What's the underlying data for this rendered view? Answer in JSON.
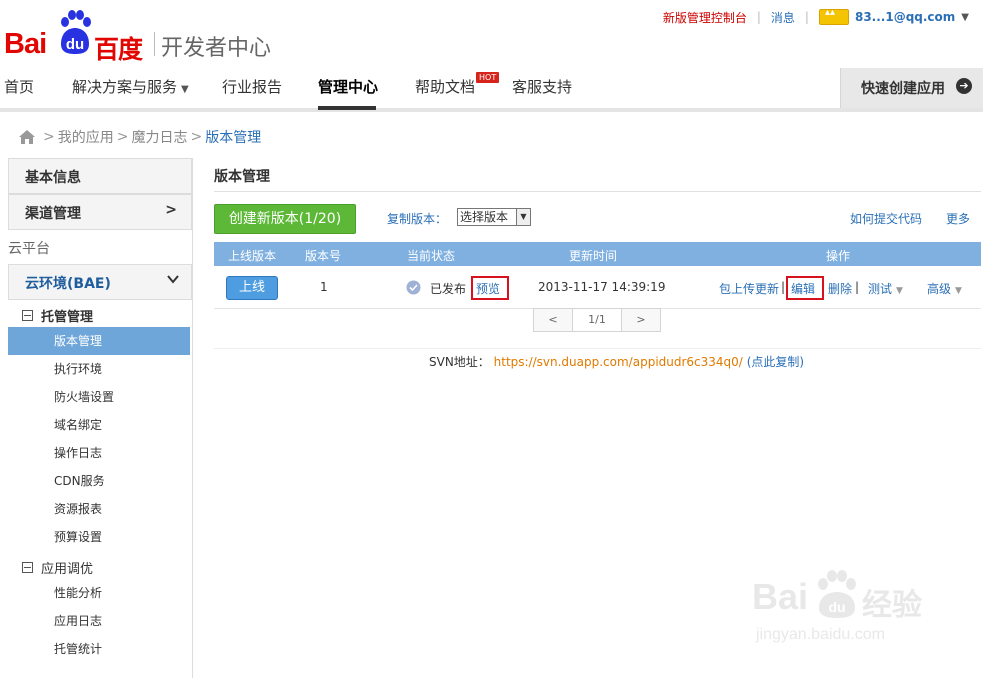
{
  "brand": {
    "logo_bai": "Bai",
    "logo_du": "du",
    "logo_cn": "百度",
    "subtitle": "开发者中心",
    "accent_color": "#e10601"
  },
  "toplinks": {
    "new_console": "新版管理控制台",
    "messages": "消息",
    "user": "83...1@qq.com"
  },
  "nav": {
    "items": [
      "首页",
      "解决方案与服务",
      "行业报告",
      "管理中心",
      "帮助文档",
      "客服支持"
    ],
    "hot_badge": "HOT",
    "quick_create": "快速创建应用",
    "active_index": 3
  },
  "breadcrumb": {
    "items": [
      "我的应用",
      "魔力日志",
      "版本管理"
    ],
    "separator": ">"
  },
  "sidebar": {
    "basic_info": "基本信息",
    "channel_mgmt": "渠道管理",
    "cloud_platform": "云平台",
    "cloud_env": "云环境(BAE)",
    "group_hosting": "托管管理",
    "hosting_items": [
      "版本管理",
      "执行环境",
      "防火墙设置",
      "域名绑定",
      "操作日志",
      "CDN服务",
      "资源报表",
      "预算设置"
    ],
    "group_tuning": "应用调优",
    "tuning_items": [
      "性能分析",
      "应用日志",
      "托管统计"
    ],
    "active_item": "版本管理",
    "active_color": "#6fa6d9"
  },
  "main": {
    "title": "版本管理",
    "create_button": "创建新版本(1/20)",
    "copy_version_label": "复制版本：",
    "select_value": "选择版本",
    "how_to_submit": "如何提交代码",
    "more": "更多",
    "table": {
      "headers": [
        "上线版本",
        "版本号",
        "当前状态",
        "更新时间",
        "操作"
      ],
      "rows": [
        {
          "online": "上线",
          "version": "1",
          "status": "已发布",
          "preview": "预览",
          "updated": "2013-11-17 14:39:19",
          "op_upload": "包上传更新",
          "op_edit": "编辑",
          "op_delete": "删除",
          "op_test": "测试",
          "op_advanced": "高级"
        }
      ]
    },
    "pager": {
      "prev": "<",
      "page": "1/1",
      "next": ">"
    },
    "svn": {
      "label": "SVN地址：",
      "url": "https://svn.duapp.com/appidudr6c334q0/",
      "copy": "(点此复制)"
    }
  },
  "watermark": {
    "bai": "Bai",
    "du": "du",
    "jingyan": "经验",
    "url": "jingyan.baidu.com"
  }
}
